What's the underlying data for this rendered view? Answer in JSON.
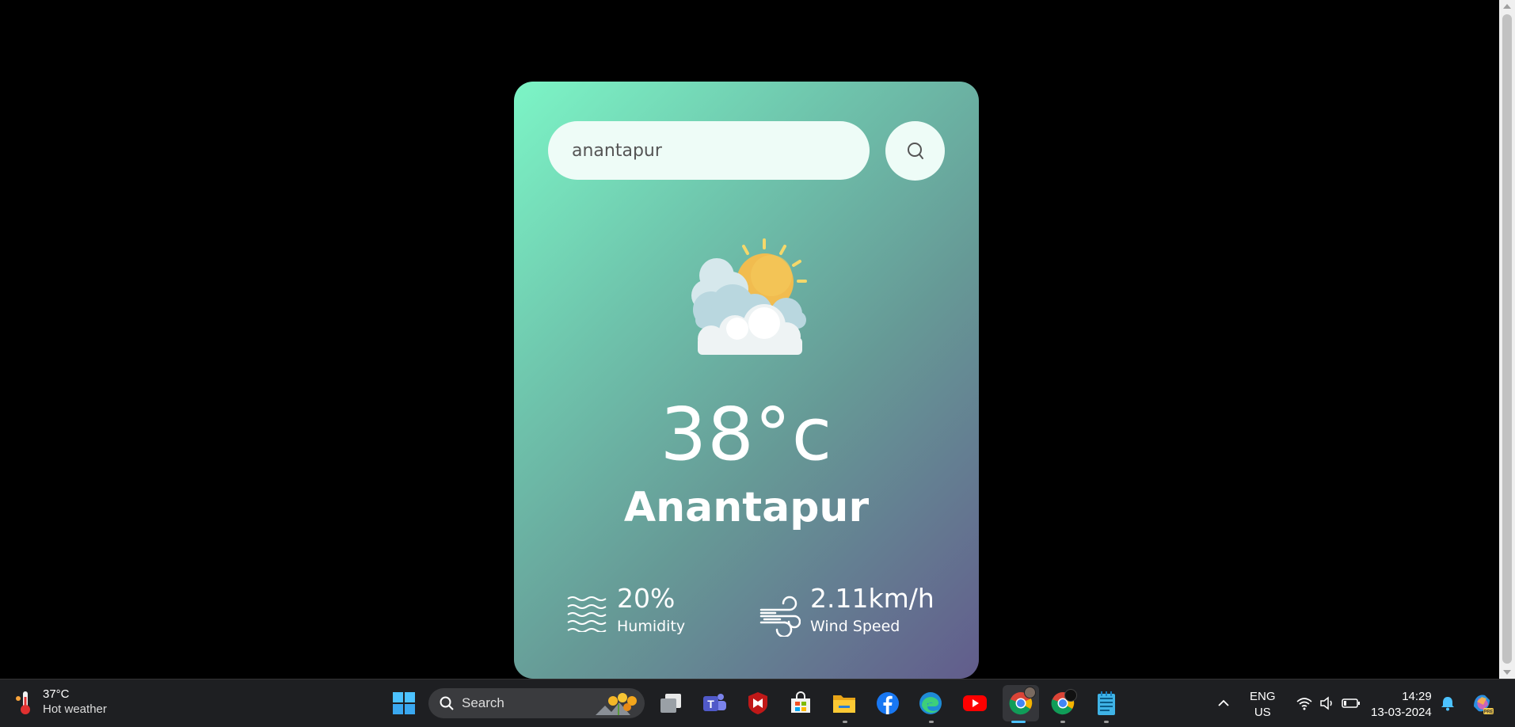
{
  "search": {
    "value": "anantapur"
  },
  "weather": {
    "temperature": "38°c",
    "city": "Anantapur",
    "humidity_value": "20%",
    "humidity_label": "Humidity",
    "wind_value": "2.11km/h",
    "wind_label": "Wind Speed"
  },
  "colors": {
    "card_gradient_start": "#7cf5c6",
    "card_gradient_end": "#625c8c",
    "input_bg": "#eefcf7",
    "background": "#000000"
  },
  "taskbar": {
    "weather_temp": "37°C",
    "weather_condition": "Hot weather",
    "search_label": "Search",
    "lang_line1": "ENG",
    "lang_line2": "US",
    "time": "14:29",
    "date": "13-03-2024",
    "apps": [
      "start-icon",
      "task-view-icon",
      "teams-icon",
      "mcafee-icon",
      "store-icon",
      "file-explorer-icon",
      "facebook-icon",
      "edge-icon",
      "youtube-icon",
      "chrome-icon",
      "chrome-profile-icon",
      "notepad-icon"
    ]
  }
}
